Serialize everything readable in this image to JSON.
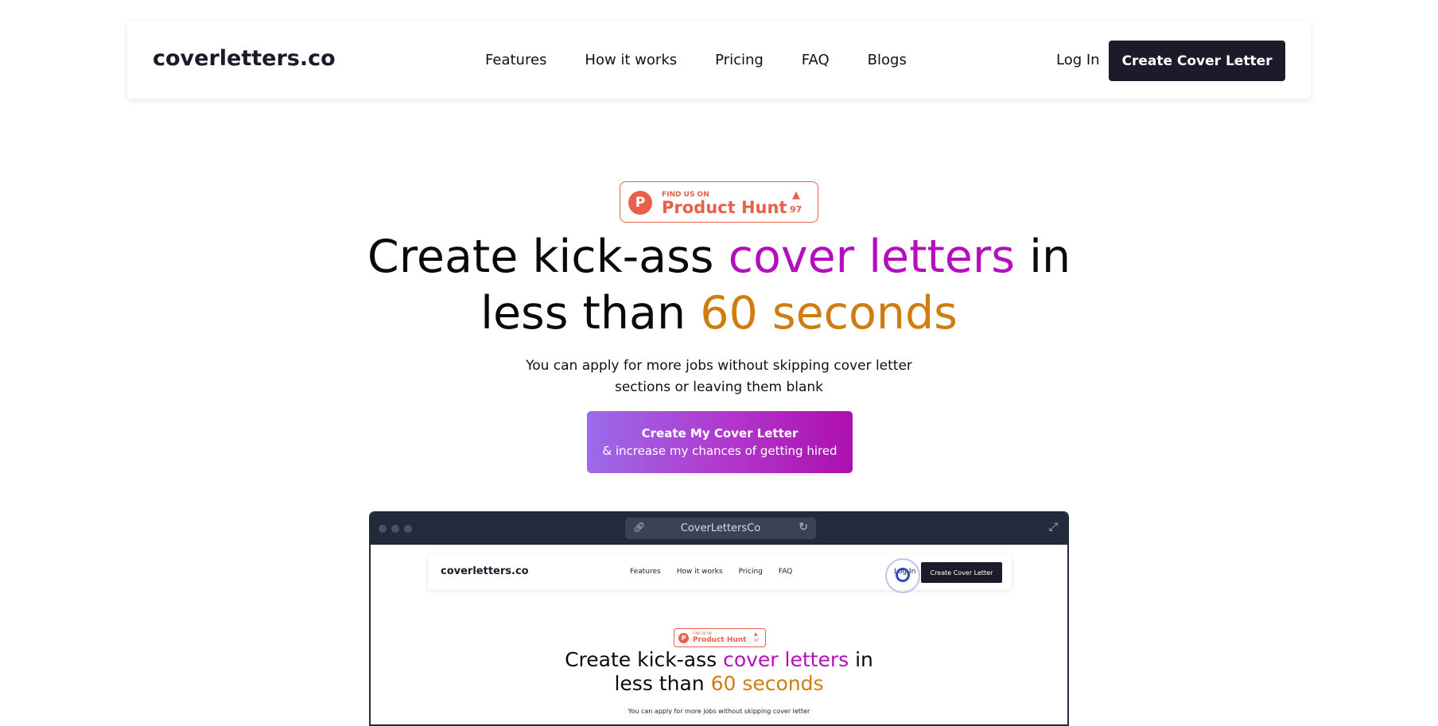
{
  "nav": {
    "logo": "coverletters.co",
    "links": [
      "Features",
      "How it works",
      "Pricing",
      "FAQ",
      "Blogs"
    ],
    "login": "Log In",
    "cta": "Create Cover Letter"
  },
  "product_hunt": {
    "find_label": "FIND US ON",
    "name": "Product Hunt",
    "logo_letter": "P",
    "arrow": "▲",
    "votes": "97"
  },
  "hero": {
    "line1_pre": "Create kick-ass ",
    "line1_highlight": "cover letters",
    "line1_post": " in",
    "line2_pre": "less than ",
    "line2_highlight": "60 seconds",
    "subtitle_line1": "You can apply for more jobs without skipping cover letter",
    "subtitle_line2": "sections or leaving them blank",
    "cta_line1": "Create My Cover Letter",
    "cta_line2": "& increase my chances of getting hired"
  },
  "browser_preview": {
    "url_label": "CoverLettersCo",
    "mini_logo": "coverletters.co",
    "mini_links": [
      "Features",
      "How it works",
      "Pricing",
      "FAQ"
    ],
    "mini_login": "Log In",
    "mini_cta": "Create Cover Letter",
    "mini_find_label": "FIND US ON",
    "mini_ph_name": "Product Hunt",
    "mini_ph_letter": "P",
    "mini_ph_arrow": "▲",
    "mini_ph_votes": "97",
    "mini_line1_pre": "Create kick-ass ",
    "mini_line1_highlight": "cover letters",
    "mini_line1_post": " in",
    "mini_line2_pre": "less than ",
    "mini_line2_highlight": "60 seconds",
    "mini_subtitle": "You can apply for more jobs without skipping cover letter"
  },
  "colors": {
    "accent_pink": "#b40fbd",
    "accent_gold": "#cf7d11",
    "product_hunt": "#e8604a",
    "dark": "#1c1b2b"
  }
}
